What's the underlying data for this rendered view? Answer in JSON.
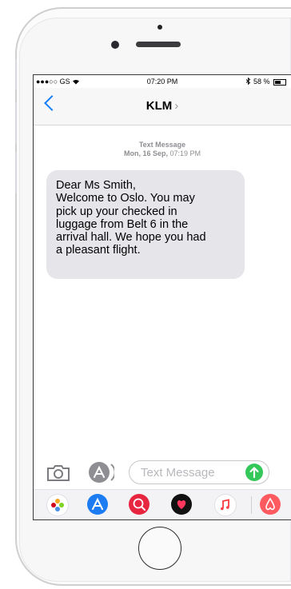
{
  "status_bar": {
    "carrier": "●●●○○ GS",
    "time": "07:20 PM",
    "battery": "58 %",
    "battery_level": 0.58
  },
  "navbar": {
    "title": "KLM",
    "chevron": "›"
  },
  "message_meta": {
    "type": "Text Message",
    "date": "Mon, 16 Sep,",
    "time": "07:19 PM"
  },
  "message": {
    "lines": [
      "Dear Ms Smith,",
      "Welcome to Oslo. You may",
      "pick up your checked in",
      "luggage from Belt 6 in the",
      "arrival hall. We hope you had",
      "a pleasant flight."
    ]
  },
  "composer": {
    "placeholder": "Text Message"
  },
  "icons": {
    "back": "chevron-left-icon",
    "camera": "camera-icon",
    "apps": "app-store-icon",
    "send": "send-arrow-icon"
  },
  "colors": {
    "accent": "#157efb",
    "bubble": "#e5e5ea",
    "send": "#34c759"
  }
}
